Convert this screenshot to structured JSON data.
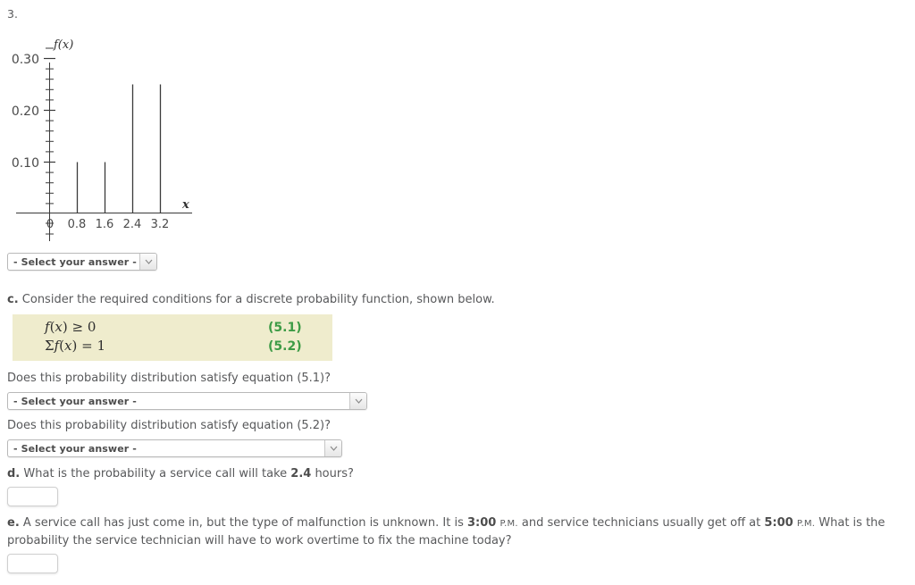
{
  "question_number": "3.",
  "chart_data": {
    "type": "bar",
    "title": "",
    "xlabel": "x",
    "ylabel": "f(x)",
    "categories": [
      "0.8",
      "1.6",
      "2.4",
      "3.2"
    ],
    "values": [
      0.1,
      0.1,
      0.25,
      0.25
    ],
    "x_tick_labels": [
      "0",
      "0.8",
      "1.6",
      "2.4",
      "3.2"
    ],
    "y_tick_labels": [
      "0.10",
      "0.20",
      "0.30"
    ],
    "y_tick_values": [
      0.1,
      0.2,
      0.3
    ],
    "y_minor_tick_step": 0.02,
    "ylim": [
      0,
      0.32
    ],
    "grid": false,
    "legend": false,
    "style": "spike-plot"
  },
  "select_a": {
    "label": "- Select your answer -",
    "arrow_icon": "chevron-down-icon"
  },
  "part_c": {
    "prompt_prefix": "c.",
    "prompt_text": " Consider the required conditions for a discrete probability function, shown below.",
    "equations": [
      {
        "formula_html": "<i>f</i>(<i>x</i>) ≥ 0",
        "number": "(5.1)"
      },
      {
        "formula_html": "Σ<i>f</i>(<i>x</i>) = 1",
        "number": "(5.2)"
      }
    ],
    "question_1": "Does this probability distribution satisfy equation (5.1)?",
    "select_1": {
      "label": "- Select your answer -",
      "arrow_icon": "chevron-down-icon"
    },
    "question_2": "Does this probability distribution satisfy equation (5.2)?",
    "select_2": {
      "label": "- Select your answer -",
      "arrow_icon": "chevron-down-icon"
    }
  },
  "part_d": {
    "prefix": "d.",
    "text_before": " What is the probability a service call will take ",
    "bold_value": "2.4",
    "text_after": " hours?",
    "answer_value": "",
    "answer_placeholder": ""
  },
  "part_e": {
    "prefix": "e.",
    "seg_1": " A service call has just come in, but the type of malfunction is unknown. It is ",
    "time_1": "3:00",
    "ampm_1": "P.M.",
    "seg_2": " and service technicians usually get off at ",
    "time_2": "5:00",
    "ampm_2": "P.M.",
    "seg_3": " What is the probability the service technician will have to work overtime to fix the machine today?",
    "answer_value": "",
    "answer_placeholder": ""
  },
  "colors": {
    "text": "#58595b",
    "equation_box_bg": "#efeccd",
    "equation_number_green": "#3d9b46",
    "select_border": "#b9b9b9",
    "input_border": "#cfcfcf",
    "axis": "#3a3a3a"
  }
}
